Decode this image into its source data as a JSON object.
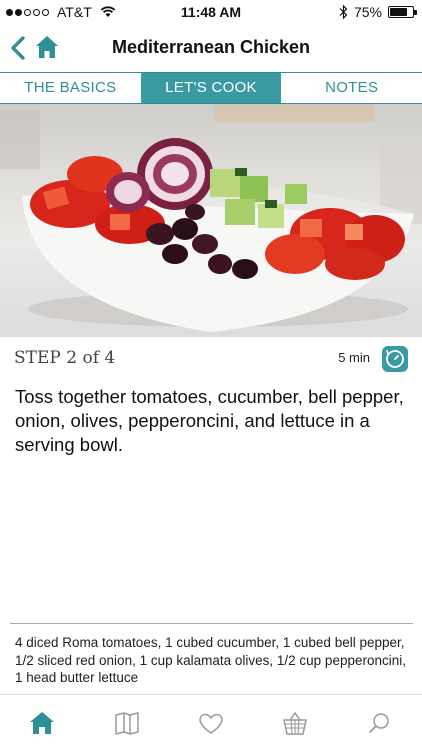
{
  "status_bar": {
    "carrier": "AT&T",
    "time": "11:48 AM",
    "battery": "75%",
    "battery_level": 0.75,
    "signal_bars": 2
  },
  "nav": {
    "title": "Mediterranean Chicken",
    "back_icon": "chevron-left-icon",
    "home_icon": "home-icon"
  },
  "tabs": [
    {
      "label": "THE BASICS",
      "active": false
    },
    {
      "label": "LET'S COOK",
      "active": true
    },
    {
      "label": "NOTES",
      "active": false
    }
  ],
  "step": {
    "label": "STEP 2 of 4",
    "time": "5 min",
    "instruction": "Toss together tomatoes, cucumber, bell pepper, onion, olives, pepperoncini, and lettuce in a serving bowl.",
    "ingredients": "4 diced Roma tomatoes, 1 cubed cucumber, 1 cubed bell pepper, 1/2 sliced red onion, 1 cup kalamata olives, 1/2 cup pepperoncini, 1 head butter lettuce"
  },
  "tabbar": {
    "items": [
      "home-icon",
      "book-icon",
      "heart-icon",
      "basket-icon",
      "search-icon"
    ],
    "active": "home-icon"
  },
  "colors": {
    "accent": "#3a9aa1",
    "accent_text": "#2f8f97"
  }
}
